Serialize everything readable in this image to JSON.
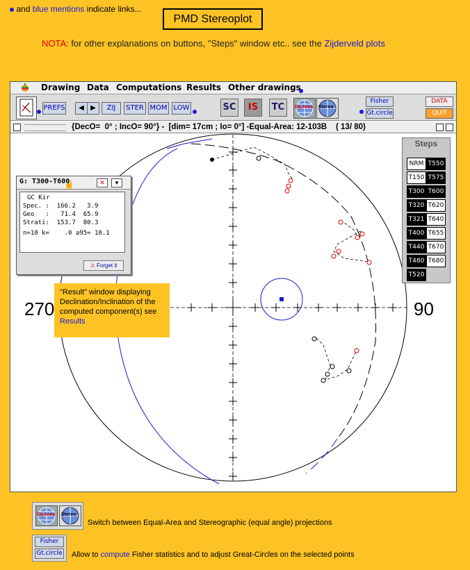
{
  "top_note": {
    "and": "and",
    "blue": "blue mentions",
    "rest": "indicate links..."
  },
  "title": "PMD Stereoplot",
  "nota": {
    "label": "NOTA:",
    "text": " for other explanations on buttons, \"Steps\" window etc.. see the ",
    "link": "Zijderveld plots"
  },
  "menu": [
    "Drawing",
    "Data",
    "Computations",
    "Results",
    "Other drawings"
  ],
  "toolbar": {
    "prefs": "PREFS",
    "zij": "ZIJ",
    "ster": "STER",
    "mom": "MOM",
    "low": "LOW",
    "sc": "SC",
    "is": "IS",
    "tc": "TC",
    "eqarea": "Eq.Area",
    "stereo": "Stereo",
    "fisher": "Fisher",
    "gtcircle": "Gt.circle",
    "data": "DATA",
    "quit": "QUIT"
  },
  "window_title": "{DecO=  0° ; IncO= 90°} -  [dim= 17cm ; Io= 0°] -Equal-Area: 12-103B    ( 13/ 80)",
  "axis_labels": {
    "left": "270",
    "right": "90"
  },
  "steps": {
    "title": "Steps",
    "left": [
      {
        "label": "NRM",
        "dark": false
      },
      {
        "label": "T150",
        "dark": false
      },
      {
        "label": "T300",
        "dark": true
      },
      {
        "label": "T320",
        "dark": true
      },
      {
        "label": "T321",
        "dark": true
      },
      {
        "label": "T400",
        "dark": true
      },
      {
        "label": "T440",
        "dark": true
      },
      {
        "label": "T480",
        "dark": true
      },
      {
        "label": "T520",
        "dark": true
      }
    ],
    "right": [
      {
        "label": "T550",
        "dark": true
      },
      {
        "label": "T575",
        "dark": true
      },
      {
        "label": "T600",
        "dark": true
      },
      {
        "label": "T620",
        "dark": false
      },
      {
        "label": "T640",
        "dark": false
      },
      {
        "label": "T655",
        "dark": false
      },
      {
        "label": "T670",
        "dark": false
      },
      {
        "label": "T680",
        "dark": false
      }
    ]
  },
  "result": {
    "title": "G:  T300-T600",
    "type": "GC Kir",
    "rows": [
      "Spec. :  166.2   3.9",
      "Geo   :   71.4  65.9",
      "Strati:  153.7  80.3"
    ],
    "stats": "n=10 k=    .0 a95= 10.1",
    "forget": "Forget it"
  },
  "callout": {
    "text": "\"Result\" window displaying Declination/Inclination of the computed component(s) see ",
    "link": "Results"
  },
  "footer": {
    "proj_text": "Switch between Equal-Area and Stereographic (equal angle) projections",
    "fisher_pre": "Allow to ",
    "fisher_link": "compute",
    "fisher_post": " Fisher statistics and to adjust Great-Circles on the selected points",
    "fisher_btn": "Fisher",
    "gt_btn": "Gt.circle",
    "eqarea": "Eq.Area",
    "stereo": "Stereo"
  }
}
